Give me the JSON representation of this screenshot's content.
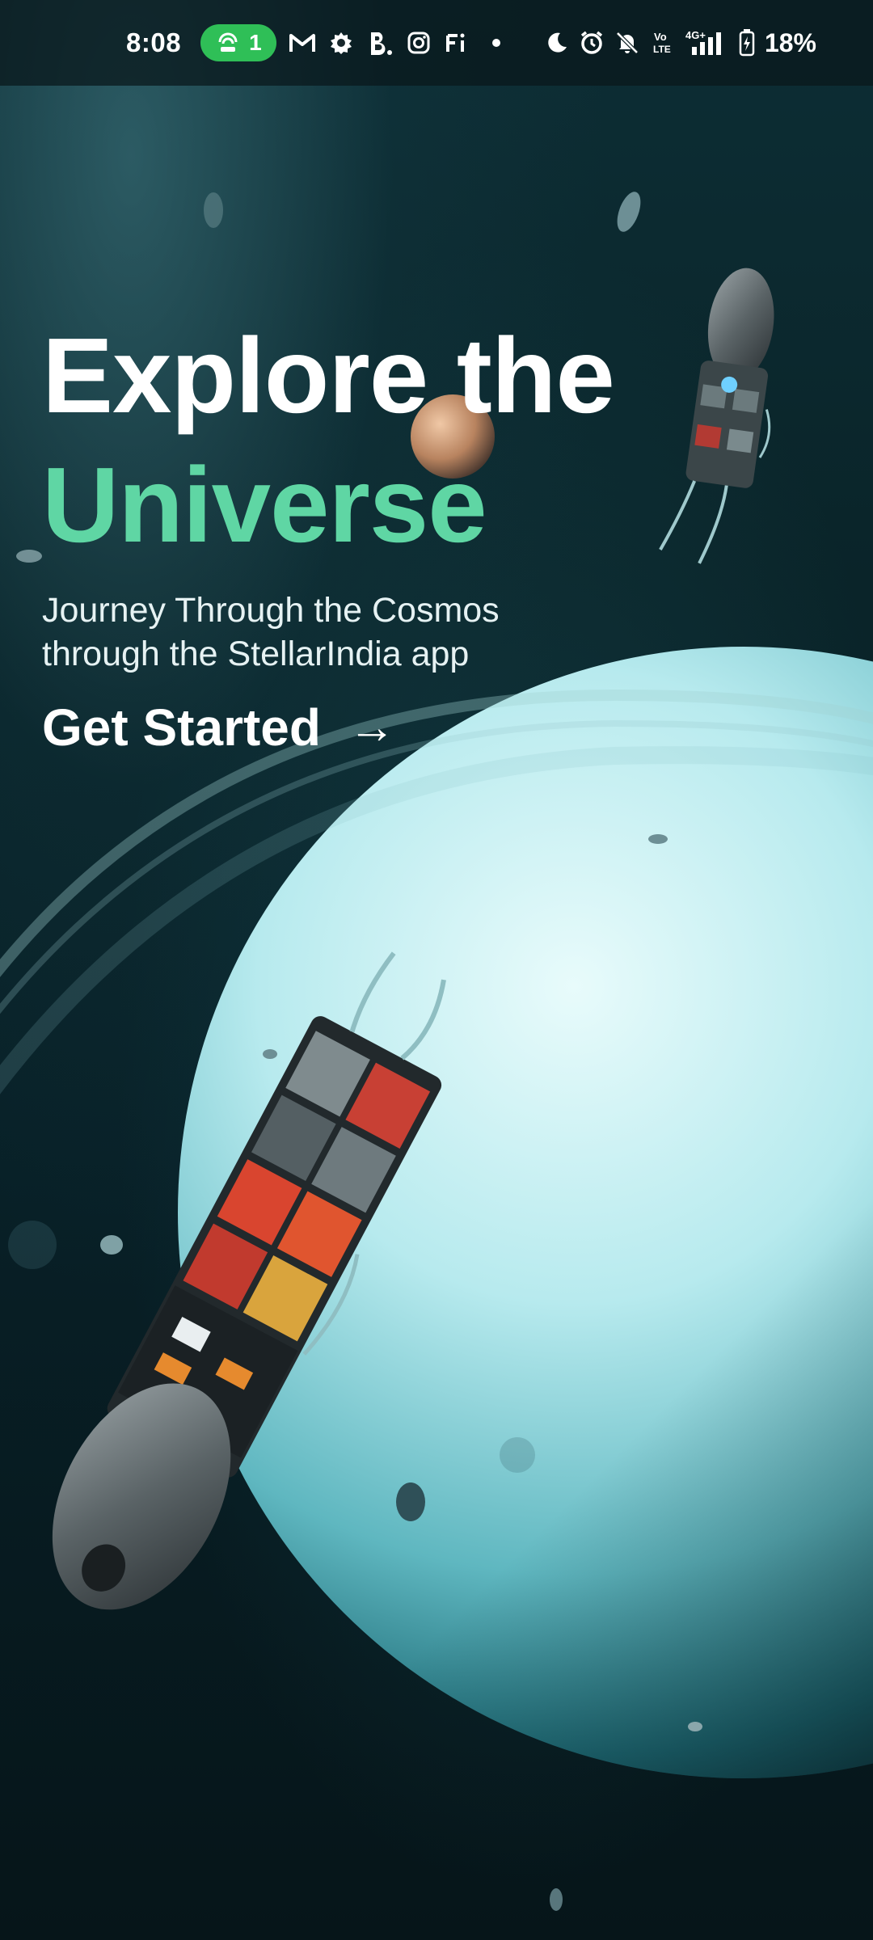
{
  "status_bar": {
    "time": "8:08",
    "hotspot_count": "1",
    "battery_percent": "18%",
    "network_label": "4G+",
    "volte_label": "Vo LTE",
    "notification_icons": [
      "hotspot-icon",
      "gmail-icon",
      "badge-app-icon",
      "booking-icon",
      "instagram-icon",
      "fi-icon",
      "more-dot-icon"
    ],
    "system_icons": [
      "moon-icon",
      "alarm-icon",
      "bell-muted-icon",
      "volte-icon",
      "signal-icon",
      "battery-icon"
    ],
    "pill_color": "#2fbf57"
  },
  "hero": {
    "title_line1": "Explore the",
    "title_line2": "Universe",
    "title_accent_color": "#5fd6a4"
  },
  "subtitle": {
    "line1": "Journey Through the Cosmos",
    "line2": "through the StellarIndia app"
  },
  "cta": {
    "label": "Get Started",
    "arrow": "→"
  }
}
